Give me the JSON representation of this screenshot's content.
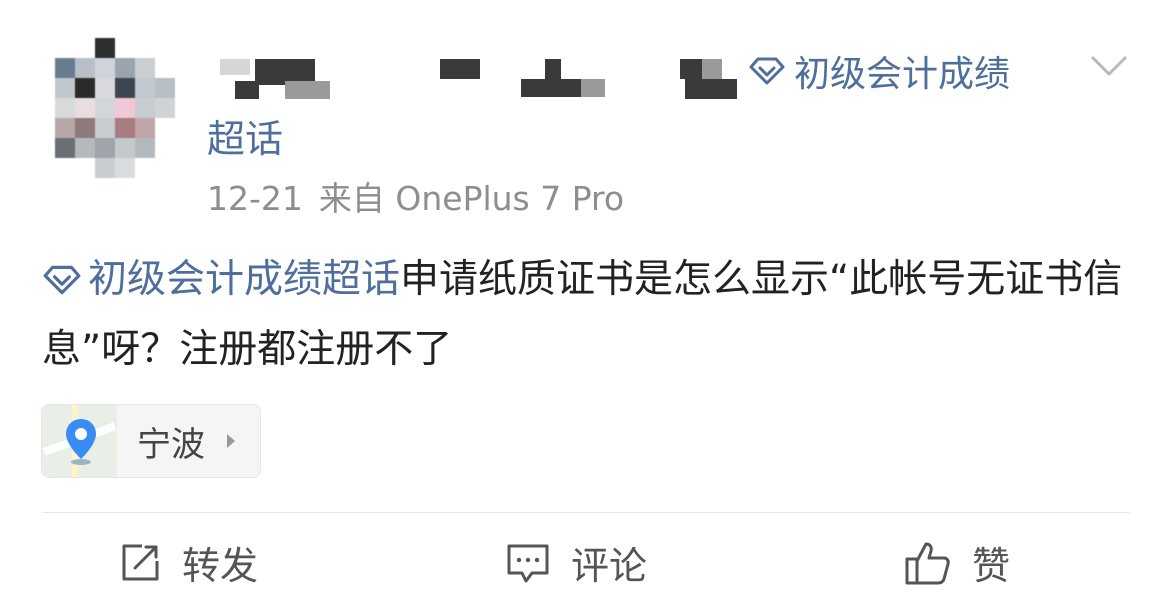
{
  "header": {
    "topic_tag": "初级会计成绩",
    "super_label": "超话",
    "date": "12-21",
    "source": "来自 OnePlus 7 Pro"
  },
  "post": {
    "topic_link": "初级会计成绩超话",
    "body": "申请纸质证书是怎么显示“此帐号无证书信息”呀？注册都注册不了"
  },
  "location": {
    "name": "宁波"
  },
  "actions": {
    "repost": "转发",
    "comment": "评论",
    "like": "赞"
  },
  "icons": {
    "topic": "diamond-icon",
    "chevron": "chevron-down-icon",
    "location": "map-pin-icon",
    "repost": "repost-icon",
    "comment": "comment-icon",
    "like": "thumbs-up-icon"
  },
  "colors": {
    "link": "#4e6f9c",
    "pin": "#3b8cf2"
  }
}
